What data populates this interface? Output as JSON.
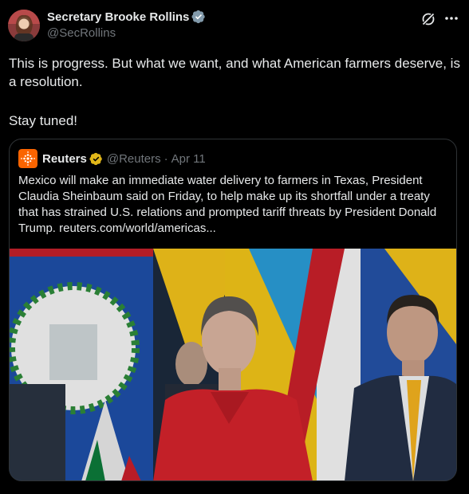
{
  "post": {
    "display_name": "Secretary Brooke Rollins",
    "handle": "@SecRollins",
    "text_line1": "This is progress. But what we want, and what American farmers deserve, is a resolution.",
    "text_line2": "Stay tuned!"
  },
  "quote": {
    "name": "Reuters",
    "handle": "@Reuters",
    "separator": "·",
    "date": "Apr 11",
    "text": "Mexico will make an immediate water delivery to farmers in Texas, President Claudia Sheinbaum said on Friday, to help make up its shortfall under a treaty that has strained U.S. relations and prompted tariff threats by President Donald Trump. reuters.com/world/americas..."
  },
  "colors": {
    "background": "#000000",
    "text": "#e7e9ea",
    "muted": "#71767b",
    "verified_gold": "#e2b719",
    "verified_blue": "#1d9bf0",
    "reuters_orange": "#fa6400"
  },
  "icons": {
    "verified": "verified-badge-icon",
    "grok": "grok-icon",
    "more": "more-icon"
  }
}
